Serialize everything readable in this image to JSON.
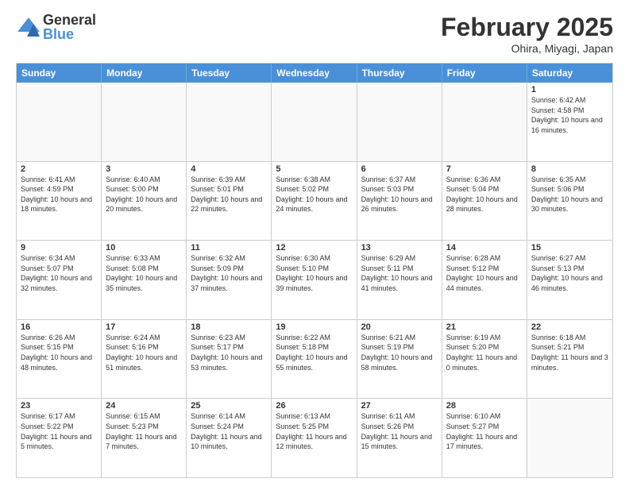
{
  "logo": {
    "general": "General",
    "blue": "Blue"
  },
  "title": "February 2025",
  "location": "Ohira, Miyagi, Japan",
  "weekdays": [
    "Sunday",
    "Monday",
    "Tuesday",
    "Wednesday",
    "Thursday",
    "Friday",
    "Saturday"
  ],
  "weeks": [
    [
      {
        "day": "",
        "info": ""
      },
      {
        "day": "",
        "info": ""
      },
      {
        "day": "",
        "info": ""
      },
      {
        "day": "",
        "info": ""
      },
      {
        "day": "",
        "info": ""
      },
      {
        "day": "",
        "info": ""
      },
      {
        "day": "1",
        "info": "Sunrise: 6:42 AM\nSunset: 4:58 PM\nDaylight: 10 hours and 16 minutes."
      }
    ],
    [
      {
        "day": "2",
        "info": "Sunrise: 6:41 AM\nSunset: 4:59 PM\nDaylight: 10 hours and 18 minutes."
      },
      {
        "day": "3",
        "info": "Sunrise: 6:40 AM\nSunset: 5:00 PM\nDaylight: 10 hours and 20 minutes."
      },
      {
        "day": "4",
        "info": "Sunrise: 6:39 AM\nSunset: 5:01 PM\nDaylight: 10 hours and 22 minutes."
      },
      {
        "day": "5",
        "info": "Sunrise: 6:38 AM\nSunset: 5:02 PM\nDaylight: 10 hours and 24 minutes."
      },
      {
        "day": "6",
        "info": "Sunrise: 6:37 AM\nSunset: 5:03 PM\nDaylight: 10 hours and 26 minutes."
      },
      {
        "day": "7",
        "info": "Sunrise: 6:36 AM\nSunset: 5:04 PM\nDaylight: 10 hours and 28 minutes."
      },
      {
        "day": "8",
        "info": "Sunrise: 6:35 AM\nSunset: 5:06 PM\nDaylight: 10 hours and 30 minutes."
      }
    ],
    [
      {
        "day": "9",
        "info": "Sunrise: 6:34 AM\nSunset: 5:07 PM\nDaylight: 10 hours and 32 minutes."
      },
      {
        "day": "10",
        "info": "Sunrise: 6:33 AM\nSunset: 5:08 PM\nDaylight: 10 hours and 35 minutes."
      },
      {
        "day": "11",
        "info": "Sunrise: 6:32 AM\nSunset: 5:09 PM\nDaylight: 10 hours and 37 minutes."
      },
      {
        "day": "12",
        "info": "Sunrise: 6:30 AM\nSunset: 5:10 PM\nDaylight: 10 hours and 39 minutes."
      },
      {
        "day": "13",
        "info": "Sunrise: 6:29 AM\nSunset: 5:11 PM\nDaylight: 10 hours and 41 minutes."
      },
      {
        "day": "14",
        "info": "Sunrise: 6:28 AM\nSunset: 5:12 PM\nDaylight: 10 hours and 44 minutes."
      },
      {
        "day": "15",
        "info": "Sunrise: 6:27 AM\nSunset: 5:13 PM\nDaylight: 10 hours and 46 minutes."
      }
    ],
    [
      {
        "day": "16",
        "info": "Sunrise: 6:26 AM\nSunset: 5:15 PM\nDaylight: 10 hours and 48 minutes."
      },
      {
        "day": "17",
        "info": "Sunrise: 6:24 AM\nSunset: 5:16 PM\nDaylight: 10 hours and 51 minutes."
      },
      {
        "day": "18",
        "info": "Sunrise: 6:23 AM\nSunset: 5:17 PM\nDaylight: 10 hours and 53 minutes."
      },
      {
        "day": "19",
        "info": "Sunrise: 6:22 AM\nSunset: 5:18 PM\nDaylight: 10 hours and 55 minutes."
      },
      {
        "day": "20",
        "info": "Sunrise: 6:21 AM\nSunset: 5:19 PM\nDaylight: 10 hours and 58 minutes."
      },
      {
        "day": "21",
        "info": "Sunrise: 6:19 AM\nSunset: 5:20 PM\nDaylight: 11 hours and 0 minutes."
      },
      {
        "day": "22",
        "info": "Sunrise: 6:18 AM\nSunset: 5:21 PM\nDaylight: 11 hours and 3 minutes."
      }
    ],
    [
      {
        "day": "23",
        "info": "Sunrise: 6:17 AM\nSunset: 5:22 PM\nDaylight: 11 hours and 5 minutes."
      },
      {
        "day": "24",
        "info": "Sunrise: 6:15 AM\nSunset: 5:23 PM\nDaylight: 11 hours and 7 minutes."
      },
      {
        "day": "25",
        "info": "Sunrise: 6:14 AM\nSunset: 5:24 PM\nDaylight: 11 hours and 10 minutes."
      },
      {
        "day": "26",
        "info": "Sunrise: 6:13 AM\nSunset: 5:25 PM\nDaylight: 11 hours and 12 minutes."
      },
      {
        "day": "27",
        "info": "Sunrise: 6:11 AM\nSunset: 5:26 PM\nDaylight: 11 hours and 15 minutes."
      },
      {
        "day": "28",
        "info": "Sunrise: 6:10 AM\nSunset: 5:27 PM\nDaylight: 11 hours and 17 minutes."
      },
      {
        "day": "",
        "info": ""
      }
    ]
  ]
}
